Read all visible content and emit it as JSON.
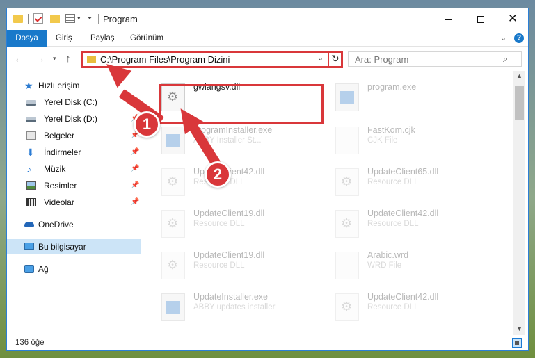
{
  "window": {
    "title": "Program"
  },
  "ribbon": {
    "tabs": [
      "Dosya",
      "Giriş",
      "Paylaş",
      "Görünüm"
    ]
  },
  "address": {
    "path": "C:\\Program Files\\Program Dizini"
  },
  "search": {
    "placeholder": "Ara: Program"
  },
  "sidebar": {
    "items": [
      {
        "label": "Hızlı erişim",
        "icon": "star-icon"
      },
      {
        "label": "Yerel Disk (C:)",
        "icon": "drive-icon",
        "pinned": true
      },
      {
        "label": "Yerel Disk (D:)",
        "icon": "drive-icon",
        "pinned": true
      },
      {
        "label": "Belgeler",
        "icon": "documents-icon",
        "pinned": true
      },
      {
        "label": "İndirmeler",
        "icon": "download-icon",
        "pinned": true
      },
      {
        "label": "Müzik",
        "icon": "music-icon",
        "pinned": true
      },
      {
        "label": "Resimler",
        "icon": "pictures-icon",
        "pinned": true
      },
      {
        "label": "Videolar",
        "icon": "videos-icon",
        "pinned": true
      },
      {
        "label": "OneDrive",
        "icon": "cloud-icon"
      },
      {
        "label": "Bu bilgisayar",
        "icon": "computer-icon",
        "selected": true
      },
      {
        "label": "Ağ",
        "icon": "network-icon"
      }
    ]
  },
  "files": [
    {
      "name": "gwlangsv.dll",
      "type": "",
      "icon": "dll-icon",
      "highlighted": true
    },
    {
      "name": "program.exe",
      "type": "",
      "icon": "exe-icon"
    },
    {
      "name": "programInstaller.exe",
      "type": "ABBY Installer St...",
      "icon": "exe-icon"
    },
    {
      "name": "FastKom.cjk",
      "type": "CJK File",
      "icon": "file-icon"
    },
    {
      "name": "UpdateClient42.dll",
      "type": "Resource DLL",
      "icon": "dll-icon"
    },
    {
      "name": "UpdateClient65.dll",
      "type": "Resource DLL",
      "icon": "dll-icon"
    },
    {
      "name": "UpdateClient19.dll",
      "type": "Resource DLL",
      "icon": "dll-icon"
    },
    {
      "name": "UpdateClient42.dll",
      "type": "Resource DLL",
      "icon": "dll-icon"
    },
    {
      "name": "UpdateClient19.dll",
      "type": "Resource DLL",
      "icon": "dll-icon"
    },
    {
      "name": "Arabic.wrd",
      "type": "WRD File",
      "icon": "file-icon"
    },
    {
      "name": "UpdateInstaller.exe",
      "type": "ABBY updates installer",
      "icon": "exe-icon"
    },
    {
      "name": "UpdateClient42.dll",
      "type": "Resource DLL",
      "icon": "dll-icon"
    }
  ],
  "status": {
    "count": "136 öğe"
  },
  "annotations": {
    "badge1": "1",
    "badge2": "2",
    "color": "#d9373a"
  }
}
